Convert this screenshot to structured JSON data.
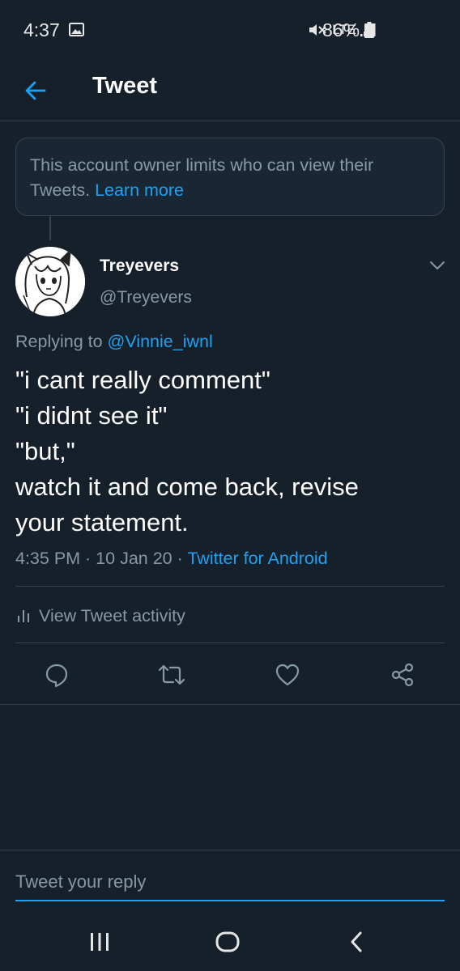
{
  "status_bar": {
    "time": "4:37",
    "network": "LTE",
    "battery": "86%"
  },
  "header": {
    "title": "Tweet"
  },
  "notice": {
    "text": "This account owner limits who can view their Tweets. ",
    "link": "Learn more"
  },
  "tweet": {
    "display_name": "Treyevers",
    "username": "@Treyevers",
    "replying_prefix": "Replying to ",
    "replying_to": "@Vinnie_iwnl",
    "lines": [
      "\"i cant really comment\"",
      "\"i didnt see it\"",
      "\"but,\"",
      "watch it and come back, revise",
      "your statement."
    ],
    "meta": "4:35 PM · 10 Jan 20 · ",
    "source": "Twitter for Android"
  },
  "activity": {
    "label": "View Tweet activity"
  },
  "reply": {
    "placeholder": "Tweet your reply"
  },
  "colors": {
    "background": "#15202b",
    "accent": "#1da1f2",
    "secondary_text": "#8899a6",
    "border": "#38444d"
  },
  "icons": {
    "back": "arrow-left-icon",
    "menu": "chevron-down-icon",
    "reply": "comment-icon",
    "retweet": "retweet-icon",
    "like": "heart-icon",
    "share": "share-icon",
    "activity": "bar-chart-icon"
  }
}
